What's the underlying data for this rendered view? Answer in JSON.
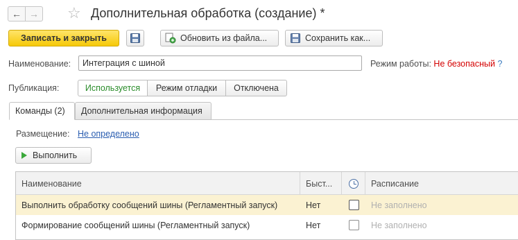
{
  "window": {
    "title": "Дополнительная обработка (создание) *",
    "back_icon": "←",
    "forward_icon": "→",
    "star_icon": "☆"
  },
  "toolbar": {
    "save_close_label": "Записать и закрыть",
    "update_from_file_label": "Обновить из файла...",
    "save_as_label": "Сохранить как..."
  },
  "form": {
    "name_label": "Наименование:",
    "name_value": "Интеграция с шиной",
    "mode_label": "Режим работы:",
    "mode_value": "Не безопасный",
    "mode_help": "?",
    "publication_label": "Публикация:",
    "publication_options": [
      "Используется",
      "Режим отладки",
      "Отключена"
    ],
    "publication_selected": "Используется"
  },
  "tabs": [
    {
      "label": "Команды (2)",
      "active": true
    },
    {
      "label": "Дополнительная информация",
      "active": false
    }
  ],
  "commands": {
    "placement_label": "Размещение:",
    "placement_value": "Не определено",
    "run_label": "Выполнить",
    "table": {
      "columns": [
        "Наименование",
        "Быст...",
        "clock-icon",
        "Расписание"
      ],
      "rows": [
        {
          "name": "Выполнить обработку сообщений шины (Регламентный запуск)",
          "fast": "Нет",
          "checked": false,
          "schedule": "Не заполнено",
          "selected": true
        },
        {
          "name": "Формирование сообщений шины (Регламентный запуск)",
          "fast": "Нет",
          "checked": false,
          "schedule": "Не заполнено",
          "selected": false
        }
      ]
    }
  },
  "colors": {
    "primary_button": "#f6c908",
    "active_segment_text": "#2a8c2a",
    "mode_value": "#d40000",
    "link": "#2a5db0",
    "selected_row": "#fbf2d2"
  }
}
